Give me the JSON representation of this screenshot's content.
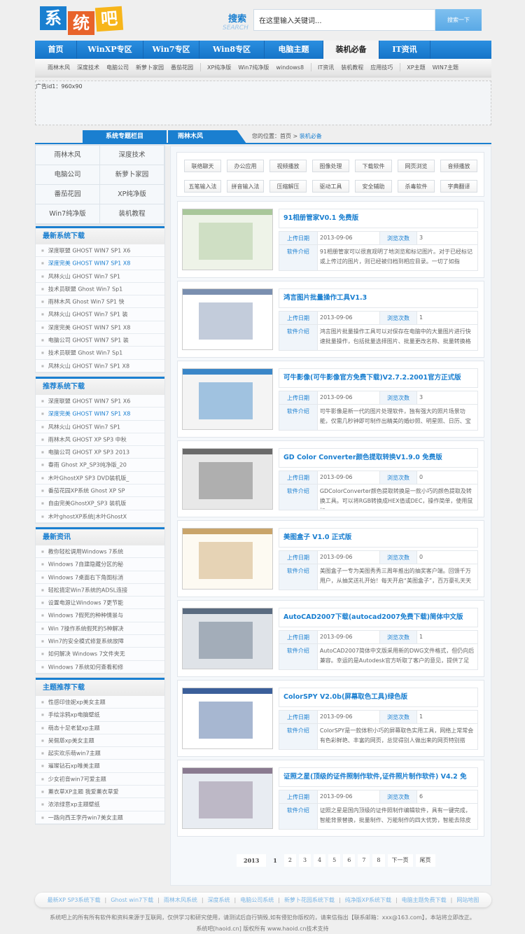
{
  "logo": {
    "chars": [
      "系",
      "统",
      "吧"
    ],
    "colors": [
      "#1a7fd0",
      "#e8632a",
      "#f7b51a"
    ]
  },
  "search": {
    "label": "搜索",
    "label_en": "SEARCH",
    "value": "在这里输入关键词...",
    "button": "搜索一下"
  },
  "nav": {
    "items": [
      "首页",
      "WinXP专区",
      "Win7专区",
      "Win8专区",
      "电脑主题",
      "装机必备",
      "IT资讯"
    ],
    "active": "装机必备"
  },
  "subnav": [
    [
      "雨林木风",
      "深度技术",
      "电脑公司",
      "新萝卜家园",
      "番茄花园"
    ],
    [
      "XP纯净版",
      "Win7纯净版",
      "windows8"
    ],
    [
      "IT资讯",
      "装机教程",
      "应用技巧"
    ],
    [
      "XP主题",
      "WIN7主题"
    ]
  ],
  "ad": {
    "label": "广告id1：960x90"
  },
  "section": {
    "left_tab": "系统专题栏目",
    "right_tab": "雨林木风",
    "crumb_prefix": "您的位置：首页 > ",
    "crumb_current": "装机必备"
  },
  "sidebar": {
    "grid": [
      "雨林木风",
      "深度技术",
      "电脑公司",
      "新萝卜家园",
      "番茄花园",
      "XP纯净版",
      "Win7纯净版",
      "装机教程"
    ],
    "blocks": [
      {
        "title": "最新系统下载",
        "items": [
          "深度联盟 GHOST WIN7 SP1 X6",
          "深度完美 GHOST WIN7 SP1 X8",
          "风林火山 GHOST Win7 SP1",
          "技术员联盟 Ghost Win7 Sp1",
          "雨林木风 Ghost Win7 SP1 快",
          "风林火山 GHOST Win7 SP1 装",
          "深度完美 GHOST WIN7 SP1 X8",
          "电脑公司 GHOST WIN7 SP1 装",
          "技术员联盟 Ghost Win7 Sp1",
          "风林火山 GHOST Win7 SP1 X8"
        ],
        "highlight": 1
      },
      {
        "title": "推荐系统下载",
        "items": [
          "深度联盟 GHOST WIN7 SP1 X6",
          "深度完美 GHOST WIN7 SP1 X8",
          "风林火山 GHOST Win7 SP1",
          "雨林木风 GHOST XP SP3 中秋",
          "电脑公司 GHOST XP SP3 2013",
          "春雨 Ghost XP_SP3纯净版_20",
          "木叶GhostXP SP3 DVD装机版_",
          "番茄花园XP系统 Ghost XP SP",
          "自由完美GhostXP_SP3 装机版",
          "木叶ghostXP系统|木叶GhostX"
        ],
        "highlight": 1
      },
      {
        "title": "最新资讯",
        "items": [
          "教你轻松调用Windows 7系统",
          "Windows 7自建隐藏分区的秘",
          "Windows 7桌面右下角图标消",
          "轻松搞定Win7系统的ADSL连接",
          "设置电源让Windows 7更节能",
          "Windows 7假死的种种情景与",
          "Win 7操作系统假死的5种解决",
          "Win7的安全模式修复系统故障",
          "如何解决 Windows 7文件夹无",
          "Windows 7系统如何查看和修"
        ],
        "highlight": -1
      },
      {
        "title": "主题推荐下载",
        "items": [
          "性感印佳妮xp美女主题",
          "手绘涂鸦xp电脑壁纸",
          "萌态十足老鼠xp主题",
          "吴佩慈xp美女主题",
          "起实欢乐萌win7主题",
          "璀璨钻石xp唯美主题",
          "少女初音win7可爱主题",
          "薰衣草XP主题 我爱薰衣草爱",
          "浓浓绿意xp主题壁纸",
          "一路向西王李丹win7美女主题"
        ],
        "highlight": -1
      }
    ]
  },
  "tags": [
    "联络聊天",
    "办公应用",
    "视频播放",
    "图像处理",
    "下载软件",
    "网页浏览",
    "音频播放",
    "五笔输入法",
    "拼音输入法",
    "压缩解压",
    "驱动工具",
    "安全辅助",
    "杀毒软件",
    "字典翻译"
  ],
  "labels": {
    "date": "上传日期",
    "views": "浏览次数",
    "intro": "软件介绍"
  },
  "software": [
    {
      "title": "91相册管家V0.1 免费版",
      "date": "2013-09-06",
      "views": "3",
      "intro": "91相册管家可以很直观明了地浏览和标记图片。对于已经标记或上传过的图片，则已经被归档到相应目录。一切了如指"
    },
    {
      "title": "鸿言图片批量操作工具V1.3",
      "date": "2013-09-06",
      "views": "1",
      "intro": "鸿言图片批量操作工具可以对保存在电脑中的大量图片进行快速批量操作，包括批量选择图片、批量更改名称、批量转换格"
    },
    {
      "title": "可牛影像(可牛影像官方免费下载)V2.7.2.2001官方正式版",
      "date": "2013-09-06",
      "views": "3",
      "intro": "可牛影像是新一代的图片处理软件，独有强大的照片场景功能，仅需几秒钟即可制作出精美的婚纱照、明星照、日历、宝"
    },
    {
      "title": "GD Color Converter颜色提取转换V1.9.0 免费版",
      "date": "2013-09-06",
      "views": "0",
      "intro": "GDColorConverter颜色提取转换是一款小巧的颜色提取及转换工具。可以将RGB转换成HEX值或DEC，操作简单，使用鼠标"
    },
    {
      "title": "美图盒子 V1.0 正式版",
      "date": "2013-09-06",
      "views": "0",
      "intro": "美图盒子一专为美图秀秀三周年推出的抽奖客户端。回馈千万用户，从抽奖送礼开始！每天开启“美图盒子”，百万豪礼天天"
    },
    {
      "title": "AutoCAD2007下载(autocad2007免费下载)简体中文版",
      "date": "2013-09-06",
      "views": "1",
      "intro": "AutoCAD2007简体中文版采用新的DWG文件格式，但仍向后兼容。幸运的是Autodesk官方听取了客户的意见，提供了足"
    },
    {
      "title": "ColorSPY V2.0b(屏幕取色工具)绿色版",
      "date": "2013-09-06",
      "views": "1",
      "intro": "ColorSPY是一款体积小巧的屏幕取色实用工具，网络上常常会有色彩鲜艳、丰富的网页，总觉得别人做出来的网页特别搭"
    },
    {
      "title": "证照之星(顶级的证件照制作软件,证件照片制作软件) V4.2 免",
      "date": "2013-09-06",
      "views": "6",
      "intro": "证照之星是国内顶级的证件照制作编辑软件，具有一键完成，智能背景替换，批量制作、万能制作的四大优势，智能去除皮"
    }
  ],
  "pager": {
    "year": "2013",
    "pages": [
      "1",
      "2",
      "3",
      "4",
      "5",
      "6",
      "7",
      "8"
    ],
    "current": "1",
    "next": "下一页",
    "last": "尾页"
  },
  "footer": {
    "links": [
      "最新XP SP3系统下载",
      "Ghost win7下载",
      "雨林木风系统",
      "深度系统",
      "电脑公司系统",
      "新萝卜花园系统下载",
      "纯净版XP系统下载",
      "电脑主题免费下载",
      "网站地图"
    ],
    "notice": "系统吧上的所有所有软件和资料来源于互联网，仅供学习和研究使用，请测试后自行销毁,如有侵犯你版权的，请来信指出【联系邮箱：xxx@163.com】，本站将立即改正。",
    "copyright": "系统吧[haoid.cn] 版权所有 www.haoid.cn技术支持"
  }
}
